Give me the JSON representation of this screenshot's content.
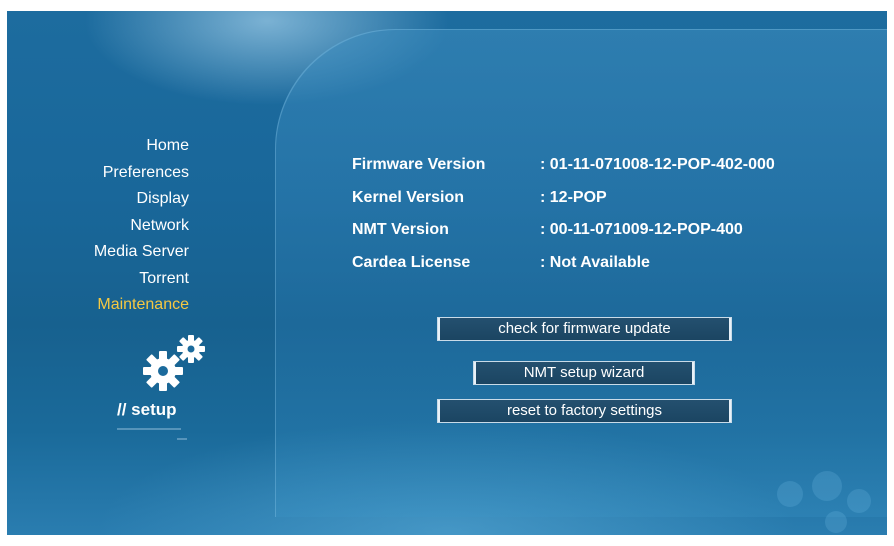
{
  "menu": {
    "items": [
      {
        "label": "Home"
      },
      {
        "label": "Preferences"
      },
      {
        "label": "Display"
      },
      {
        "label": "Network"
      },
      {
        "label": "Media Server"
      },
      {
        "label": "Torrent"
      },
      {
        "label": "Maintenance",
        "active": true
      }
    ],
    "section_label": "// setup",
    "section_icon": "gears-icon"
  },
  "info": {
    "firmware_label": "Firmware Version",
    "firmware_value": ": 01-11-071008-12-POP-402-000",
    "kernel_label": "Kernel Version",
    "kernel_value": ": 12-POP",
    "nmt_label": "NMT Version",
    "nmt_value": ": 00-11-071009-12-POP-400",
    "cardea_label": "Cardea License",
    "cardea_value": ": Not Available"
  },
  "buttons": {
    "check_update": "check for firmware update",
    "setup_wizard": "NMT setup wizard",
    "factory_reset": "reset to factory settings"
  },
  "colors": {
    "background": "#19679a",
    "active_menu": "#f5c842",
    "button_fill": "#1e4a68"
  }
}
